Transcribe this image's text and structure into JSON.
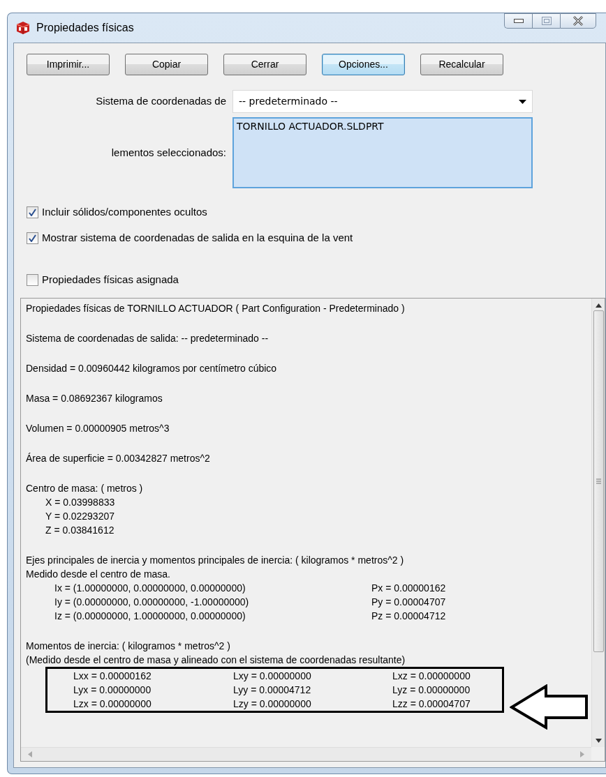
{
  "window": {
    "title": "Propiedades físicas"
  },
  "buttons": [
    {
      "label": "Imprimir...",
      "focused": false
    },
    {
      "label": "Copiar",
      "focused": false
    },
    {
      "label": "Cerrar",
      "focused": false
    },
    {
      "label": "Opciones...",
      "focused": true
    },
    {
      "label": "Recalcular",
      "focused": false
    }
  ],
  "coordinate_system": {
    "label": "Sistema de coordenadas de",
    "value": "-- predeterminado --"
  },
  "selected_items": {
    "label": "lementos seleccionados:",
    "items": [
      "TORNILLO ACTUADOR.SLDPRT"
    ]
  },
  "checkboxes": [
    {
      "label": "Incluir sólidos/componentes ocultos",
      "checked": true
    },
    {
      "label": "Mostrar sistema de coordenadas de salida en la esquina de la vent",
      "checked": true
    },
    {
      "label": "Propiedades físicas asignada",
      "checked": false
    }
  ],
  "results": {
    "sections": [
      {
        "lines": [
          {
            "kind": "text",
            "text": "Propiedades físicas de TORNILLO ACTUADOR ( Part Configuration - Predeterminado )"
          }
        ]
      },
      {
        "lines": [
          {
            "kind": "text",
            "text": "Sistema de coordenadas de salida: -- predeterminado --"
          }
        ]
      },
      {
        "lines": [
          {
            "kind": "text",
            "text": "Densidad = 0.00960442 kilogramos por centímetro cúbico"
          }
        ]
      },
      {
        "lines": [
          {
            "kind": "text",
            "text": "Masa = 0.08692367 kilogramos"
          }
        ]
      },
      {
        "lines": [
          {
            "kind": "text",
            "text": "Volumen = 0.00000905 metros^3"
          }
        ]
      },
      {
        "lines": [
          {
            "kind": "text",
            "text": "Área de superficie = 0.00342827 metros^2"
          }
        ]
      },
      {
        "lines": [
          {
            "kind": "text",
            "text": "Centro de masa: ( metros )"
          },
          {
            "kind": "indented",
            "text": "X = 0.03998833"
          },
          {
            "kind": "indented",
            "text": "Y = 0.02293207"
          },
          {
            "kind": "indented",
            "text": "Z = 0.03841612"
          }
        ]
      },
      {
        "lines": [
          {
            "kind": "text",
            "text": "Ejes principales de inercia y momentos principales de inercia: ( kilogramos * metros^2 )"
          },
          {
            "kind": "text",
            "text": "Medido desde el centro de masa."
          },
          {
            "kind": "axes",
            "cells": [
              "Ix = (1.00000000, 0.00000000, 0.00000000)",
              "Px = 0.00000162"
            ]
          },
          {
            "kind": "axes",
            "cells": [
              "Iy = (0.00000000, 0.00000000, -1.00000000)",
              "Py = 0.00004707"
            ]
          },
          {
            "kind": "axes",
            "cells": [
              "Iz = (0.00000000, 1.00000000, 0.00000000)",
              "Pz = 0.00004712"
            ]
          }
        ]
      },
      {
        "lines": [
          {
            "kind": "text",
            "text": "Momentos de inercia: ( kilogramos * metros^2 )"
          },
          {
            "kind": "text",
            "text": "(Medido desde el centro de masa y alineado con el sistema de coordenadas resultante)"
          },
          {
            "kind": "tensor",
            "highlighted": true,
            "rows": [
              [
                "Lxx = 0.00000162",
                "Lxy = 0.00000000",
                "Lxz = 0.00000000"
              ],
              [
                "Lyx = 0.00000000",
                "Lyy = 0.00004712",
                "Lyz = 0.00000000"
              ],
              [
                "Lzx = 0.00000000",
                "Lzy = 0.00000000",
                "Lzz = 0.00004707"
              ]
            ]
          }
        ]
      }
    ]
  }
}
